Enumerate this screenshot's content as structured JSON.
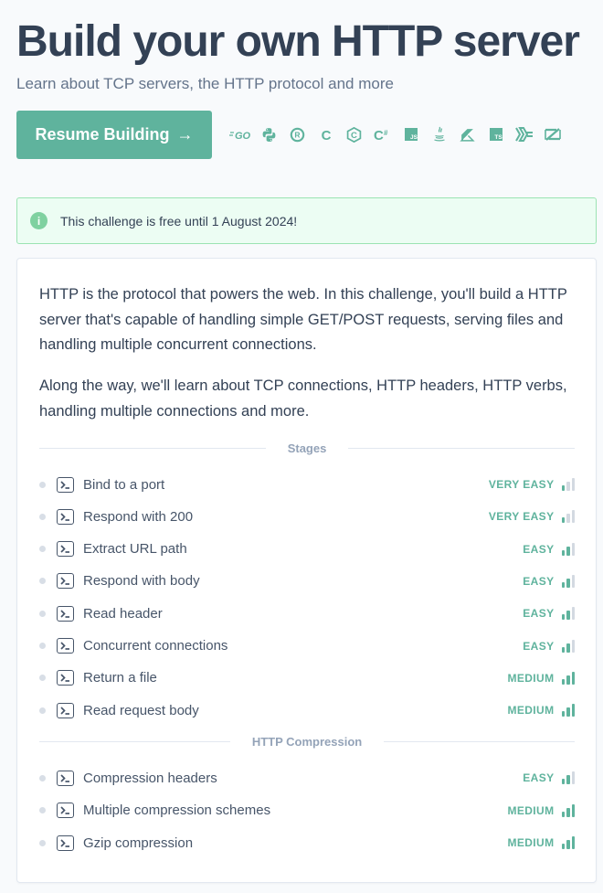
{
  "header": {
    "title": "Build your own HTTP server",
    "subtitle": "Learn about TCP servers, the HTTP protocol and more",
    "resume_label": "Resume Building",
    "resume_arrow": "→"
  },
  "languages": [
    {
      "name": "go",
      "text": "GO"
    },
    {
      "name": "python",
      "text": ""
    },
    {
      "name": "rust",
      "text": "R"
    },
    {
      "name": "c",
      "text": "C"
    },
    {
      "name": "cpp",
      "text": "C"
    },
    {
      "name": "csharp",
      "text": "C#"
    },
    {
      "name": "javascript",
      "text": "JS"
    },
    {
      "name": "java",
      "text": ""
    },
    {
      "name": "kotlin",
      "text": ""
    },
    {
      "name": "typescript",
      "text": "TS"
    },
    {
      "name": "haskell",
      "text": ""
    },
    {
      "name": "zig",
      "text": ""
    }
  ],
  "notice": {
    "icon": "i",
    "text": "This challenge is free until 1 August 2024!"
  },
  "description": {
    "p1": "HTTP is the protocol that powers the web. In this challenge, you'll build a HTTP server that's capable of handling simple GET/POST requests, serving files and handling multiple concurrent connections.",
    "p2": "Along the way, we'll learn about TCP connections, HTTP headers, HTTP verbs, handling multiple connections and more."
  },
  "sections": [
    {
      "label": "Stages",
      "stages": [
        {
          "name": "Bind to a port",
          "difficulty": "VERY EASY",
          "level": 1
        },
        {
          "name": "Respond with 200",
          "difficulty": "VERY EASY",
          "level": 1
        },
        {
          "name": "Extract URL path",
          "difficulty": "EASY",
          "level": 2
        },
        {
          "name": "Respond with body",
          "difficulty": "EASY",
          "level": 2
        },
        {
          "name": "Read header",
          "difficulty": "EASY",
          "level": 2
        },
        {
          "name": "Concurrent connections",
          "difficulty": "EASY",
          "level": 2
        },
        {
          "name": "Return a file",
          "difficulty": "MEDIUM",
          "level": 3
        },
        {
          "name": "Read request body",
          "difficulty": "MEDIUM",
          "level": 3
        }
      ]
    },
    {
      "label": "HTTP Compression",
      "stages": [
        {
          "name": "Compression headers",
          "difficulty": "EASY",
          "level": 2
        },
        {
          "name": "Multiple compression schemes",
          "difficulty": "MEDIUM",
          "level": 3
        },
        {
          "name": "Gzip compression",
          "difficulty": "MEDIUM",
          "level": 3
        }
      ]
    }
  ],
  "colors": {
    "accent": "#5fb39d",
    "bar_active": "#5fb39d",
    "bar_inactive": "#d3d9e1"
  }
}
